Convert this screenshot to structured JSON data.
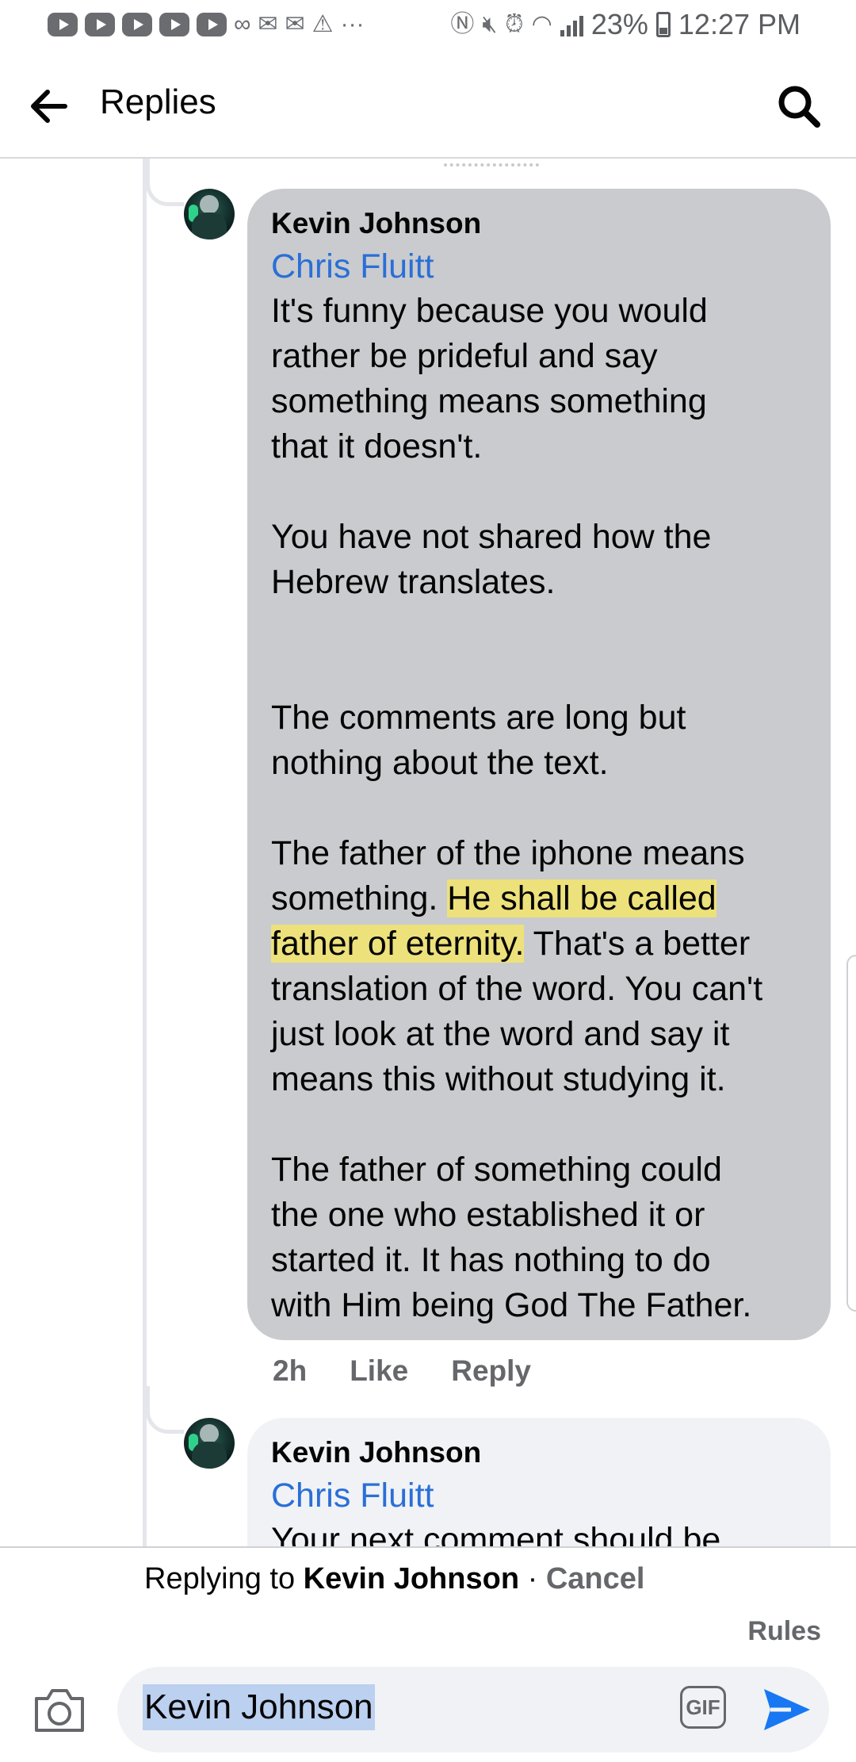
{
  "status_bar": {
    "battery": "23%",
    "time": "12:27 PM"
  },
  "header": {
    "title": "Replies"
  },
  "comments": [
    {
      "author": "Kevin Johnson",
      "mention": "Chris Fluitt",
      "text_before_highlight": "It's funny because you would\nrather be prideful and say\nsomething means something\nthat it doesn't.\n\nYou have not shared how the\nHebrew translates.\n\n\nThe comments are long but\nnothing about the text.\n\nThe father of the iphone means\nsomething. ",
      "text_highlighted": "He shall be called\nfather of eternity.",
      "text_after_highlight": " That's a better\ntranslation of the word. You can't\njust look at the word and say it\nmeans this without studying it.\n\nThe father of something could\nthe one who established it or\nstarted it. It has nothing to do\nwith Him being God The Father.",
      "time": "2h",
      "like_label": "Like",
      "reply_label": "Reply"
    },
    {
      "author": "Kevin Johnson",
      "mention": "Chris Fluitt",
      "text": "Your next comment should be"
    }
  ],
  "reply_bar": {
    "prefix": "Replying to ",
    "target": "Kevin Johnson",
    "separator": " · ",
    "cancel_label": "Cancel",
    "rules_label": "Rules",
    "input_value": "Kevin Johnson",
    "gif_label": "GIF"
  },
  "colors": {
    "accent": "#2a6fd6",
    "bubble_gray": "#c9cbce",
    "bubble_light": "#f0f2f5",
    "highlight": "#f8e860"
  }
}
